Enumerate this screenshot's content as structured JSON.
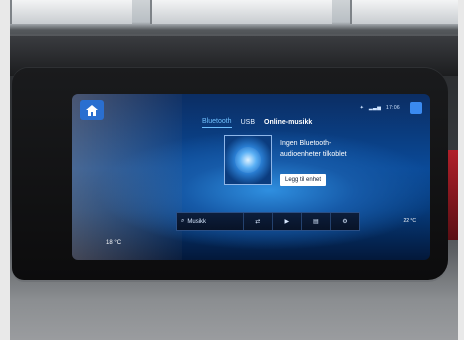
{
  "screen": {
    "tabs": [
      {
        "label": "Bluetooth",
        "active": true
      },
      {
        "label": "USB",
        "active": false
      },
      {
        "label": "Online-musikk",
        "active": false
      }
    ],
    "status_time": "17:06",
    "message_line1": "Ingen Bluetooth-",
    "message_line2": "audioenheter tilkoblet",
    "connect_label": "Legg til enhet",
    "media_bar": {
      "search_label": "Musikk",
      "icons": [
        "search-icon",
        "shuffle-icon",
        "play-icon",
        "library-icon",
        "settings-icon"
      ]
    },
    "temp_left": "18 °C",
    "temp_right": "22 °C"
  },
  "colors": {
    "screen_blue": "#0a4a98",
    "accent_blue": "#6fc0ff",
    "home_button": "#2a6fd0"
  }
}
